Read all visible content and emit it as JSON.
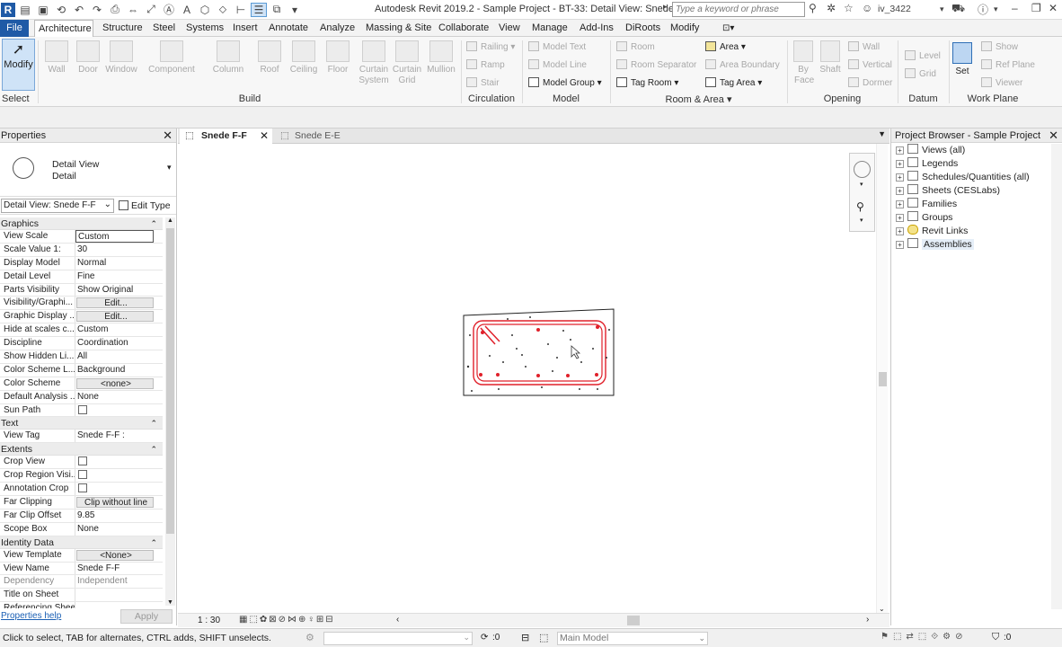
{
  "window": {
    "title": "Autodesk Revit 2019.2 - Sample Project - BT-33: Detail View: Snede F-F",
    "search_placeholder": "Type a keyword or phrase",
    "user": "iv_3422"
  },
  "ribbon_tabs": [
    "File",
    "Architecture",
    "Structure",
    "Steel",
    "Systems",
    "Insert",
    "Annotate",
    "Analyze",
    "Massing & Site",
    "Collaborate",
    "View",
    "Manage",
    "Add-Ins",
    "DiRoots",
    "Modify"
  ],
  "ribbon": {
    "modify": "Modify",
    "select": "Select",
    "build": {
      "items": [
        "Wall",
        "Door",
        "Window",
        "Component",
        "Column",
        "Roof",
        "Ceiling",
        "Floor",
        "Curtain System",
        "Curtain Grid",
        "Mullion"
      ],
      "label": "Build"
    },
    "circulation": {
      "items": [
        "Railing",
        "Ramp",
        "Stair"
      ],
      "label": "Circulation"
    },
    "model": {
      "items": [
        "Model Text",
        "Model Line",
        "Model Group"
      ],
      "label": "Model"
    },
    "room_area": {
      "items": [
        "Room",
        "Room Separator",
        "Tag Room",
        "Area",
        "Area Boundary",
        "Tag Area"
      ],
      "label": "Room & Area"
    },
    "opening": {
      "items": [
        "By Face",
        "Shaft",
        "Wall",
        "Vertical",
        "Dormer"
      ],
      "label": "Opening"
    },
    "datum": {
      "items": [
        "Level",
        "Grid"
      ],
      "label": "Datum"
    },
    "work_plane": {
      "items": [
        "Set",
        "Show",
        "Ref Plane",
        "Viewer"
      ],
      "label": "Work Plane"
    }
  },
  "properties": {
    "title": "Properties",
    "type_name": "Detail View",
    "type_sub": "Detail",
    "instance": "Detail View: Snede F-F",
    "edit_type": "Edit Type",
    "groups": [
      {
        "name": "Graphics",
        "rows": [
          {
            "k": "View Scale",
            "v": "Custom",
            "kind": "inp"
          },
          {
            "k": "Scale Value    1:",
            "v": "30"
          },
          {
            "k": "Display Model",
            "v": "Normal"
          },
          {
            "k": "Detail Level",
            "v": "Fine"
          },
          {
            "k": "Parts Visibility",
            "v": "Show Original"
          },
          {
            "k": "Visibility/Graphi...",
            "v": "Edit...",
            "kind": "btn"
          },
          {
            "k": "Graphic Display ...",
            "v": "Edit...",
            "kind": "btn"
          },
          {
            "k": "Hide at scales c...",
            "v": "Custom"
          },
          {
            "k": "Discipline",
            "v": "Coordination"
          },
          {
            "k": "Show Hidden Li...",
            "v": "All"
          },
          {
            "k": "Color Scheme L...",
            "v": "Background"
          },
          {
            "k": "Color Scheme",
            "v": "<none>",
            "kind": "btn"
          },
          {
            "k": "Default Analysis ...",
            "v": "None"
          },
          {
            "k": "Sun Path",
            "v": "",
            "kind": "cb"
          }
        ]
      },
      {
        "name": "Text",
        "rows": [
          {
            "k": "View Tag",
            "v": "Snede F-F :"
          }
        ]
      },
      {
        "name": "Extents",
        "rows": [
          {
            "k": "Crop View",
            "v": "",
            "kind": "cb"
          },
          {
            "k": "Crop Region Visi...",
            "v": "",
            "kind": "cb"
          },
          {
            "k": "Annotation Crop",
            "v": "",
            "kind": "cb"
          },
          {
            "k": "Far Clipping",
            "v": "Clip without line",
            "kind": "btn"
          },
          {
            "k": "Far Clip Offset",
            "v": "9.85"
          },
          {
            "k": "Scope Box",
            "v": "None"
          }
        ]
      },
      {
        "name": "Identity Data",
        "rows": [
          {
            "k": "View Template",
            "v": "<None>",
            "kind": "btn"
          },
          {
            "k": "View Name",
            "v": "Snede F-F"
          },
          {
            "k": "Dependency",
            "v": "Independent",
            "kind": "dim"
          },
          {
            "k": "Title on Sheet",
            "v": ""
          },
          {
            "k": "Referencing Sheet",
            "v": ""
          }
        ]
      }
    ],
    "help": "Properties help",
    "apply": "Apply"
  },
  "views": {
    "tabs": [
      "Snede F-F",
      "Snede E-E"
    ],
    "scale": "1 : 30"
  },
  "browser": {
    "title": "Project Browser - Sample Project",
    "nodes": [
      "Views (all)",
      "Legends",
      "Schedules/Quantities (all)",
      "Sheets (CESLabs)",
      "Families",
      "Groups",
      "Revit Links",
      "Assemblies"
    ]
  },
  "status": {
    "hint": "Click to select, TAB for alternates, CTRL adds, SHIFT unselects.",
    "zero": ":0",
    "model": "Main Model",
    "filter": ":0"
  },
  "colors": {
    "accent": "#1f5aa6",
    "rebar": "#e0202a"
  }
}
